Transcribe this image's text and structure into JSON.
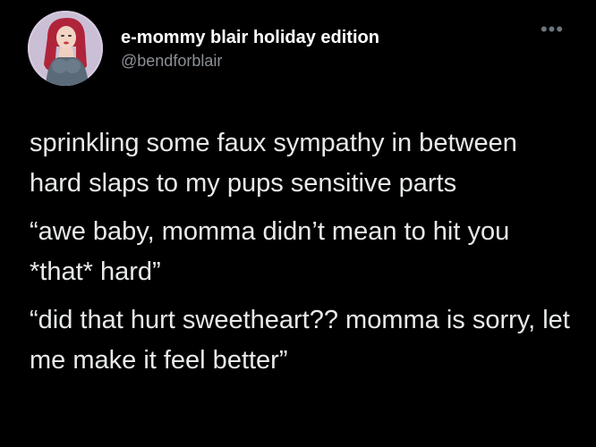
{
  "user": {
    "display_name": "e-mommy blair holiday edition",
    "handle": "@bendforblair",
    "avatar_icon": "profile-avatar"
  },
  "menu": {
    "more_icon": "more-options-icon",
    "glyph": "•••"
  },
  "tweet": {
    "paragraphs": [
      "sprinkling some faux sympathy in between hard slaps to my pups sensitive parts",
      "“awe baby, momma didn’t mean to hit you *that* hard”",
      "“did that hurt sweetheart?? momma is sorry, let me make it feel better”"
    ]
  },
  "colors": {
    "background": "#000000",
    "text": "#e7e9ea",
    "secondary": "#8b9096"
  }
}
